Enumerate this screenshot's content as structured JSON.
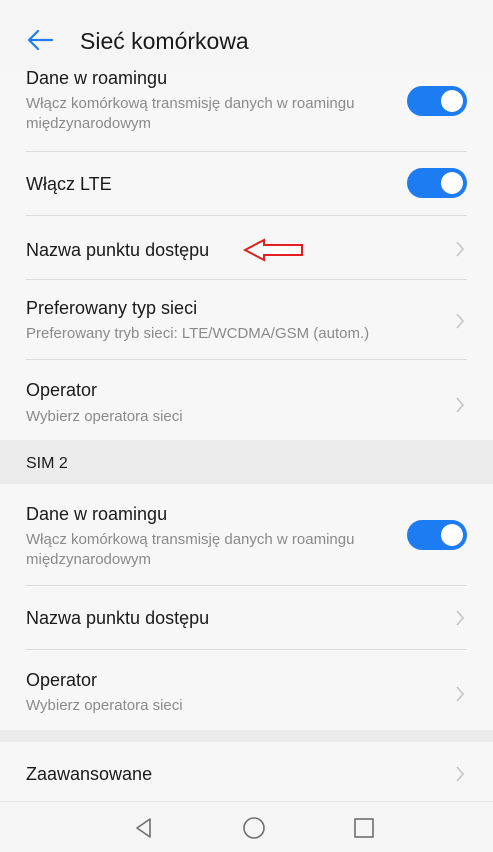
{
  "header": {
    "title": "Sieć komórkowa",
    "back_icon": "arrow-left-icon"
  },
  "sim1": {
    "roaming": {
      "label": "Dane w roamingu",
      "sub": "Włącz komórkową transmisję danych w roamingu międzynarodowym",
      "enabled": true
    },
    "lte": {
      "label": "Włącz LTE",
      "enabled": true
    },
    "apn": {
      "label": "Nazwa punktu dostępu"
    },
    "network_type": {
      "label": "Preferowany typ sieci",
      "sub": "Preferowany tryb sieci: LTE/WCDMA/GSM (autom.)"
    },
    "operator": {
      "label": "Operator",
      "sub": "Wybierz operatora sieci"
    }
  },
  "sim2": {
    "header": "SIM 2",
    "roaming": {
      "label": "Dane w roamingu",
      "sub": "Włącz komórkową transmisję danych w roamingu międzynarodowym",
      "enabled": true
    },
    "apn": {
      "label": "Nazwa punktu dostępu"
    },
    "operator": {
      "label": "Operator",
      "sub": "Wybierz operatora sieci"
    }
  },
  "advanced": {
    "label": "Zaawansowane"
  },
  "colors": {
    "accent": "#1e7cf2",
    "annotation": "#e02020"
  },
  "navbar": {
    "icons": [
      "back-triangle-icon",
      "home-circle-icon",
      "recents-square-icon"
    ]
  }
}
